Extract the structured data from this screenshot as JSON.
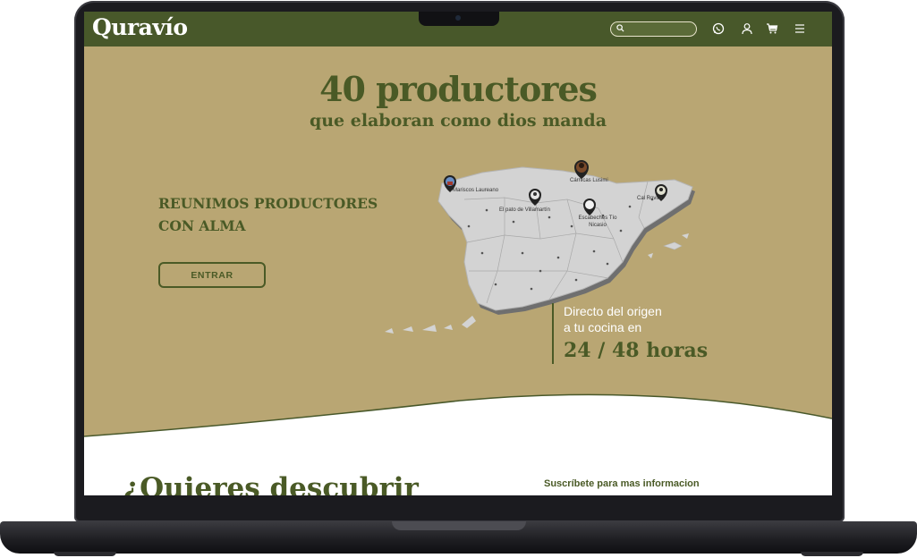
{
  "brand": {
    "name": "Quravío",
    "primary_color": "#48582a",
    "background_color": "#b9a673"
  },
  "header": {
    "search_placeholder": "",
    "icons": [
      "search-icon",
      "whatsapp-icon",
      "user-icon",
      "cart-icon",
      "menu-icon"
    ]
  },
  "hero": {
    "title": "40 productores",
    "subtitle": "que elaboran como dios manda",
    "tagline": "REUNIMOS PRODUCTORES\nCON ALMA",
    "cta_label": "ENTRAR"
  },
  "map": {
    "producers": [
      {
        "name": "Mariscos Laureano"
      },
      {
        "name": "El pato de Villamartín"
      },
      {
        "name": "Cárnicas Lusimi"
      },
      {
        "name": "Escabeches Tío Nicasio"
      },
      {
        "name": "Cal Rovira"
      }
    ]
  },
  "delivery": {
    "line1": "Directo del origen",
    "line2": "a tu cocina en",
    "hours": "24 / 48 horas"
  },
  "footer_section": {
    "heading": "¿Quieres descubrir",
    "subscribe_text": "Suscríbete para mas informacion"
  }
}
